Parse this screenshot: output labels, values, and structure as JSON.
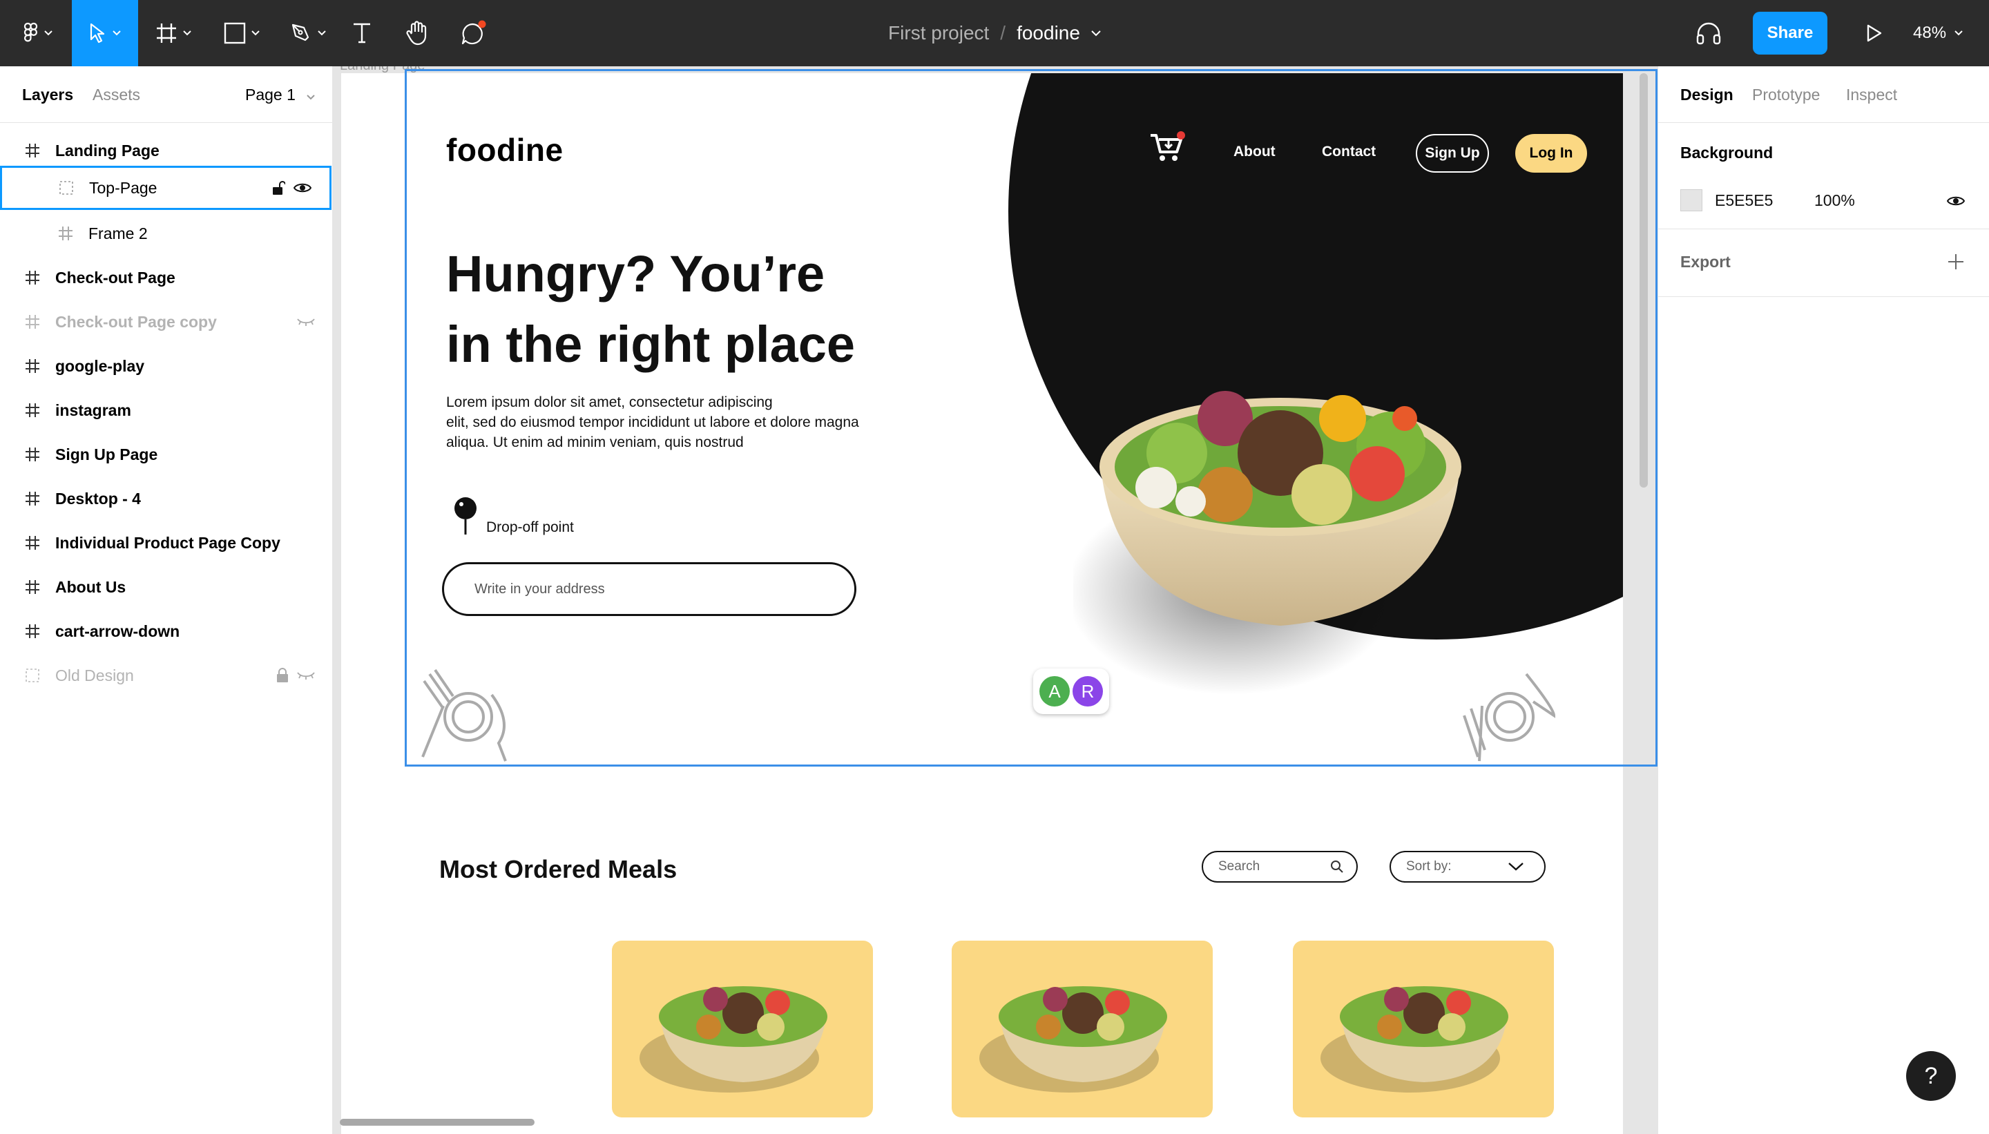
{
  "toolbar": {
    "project": "First project",
    "separator": "/",
    "file": "foodine",
    "share_label": "Share",
    "zoom": "48%",
    "accent": "#0d99ff"
  },
  "left_panel": {
    "tabs": [
      "Layers",
      "Assets"
    ],
    "page_selector": "Page 1",
    "layers": [
      {
        "name": "Landing Page",
        "icon": "frame-icon"
      },
      {
        "name": "Top-Page",
        "icon": "group-icon",
        "child": true,
        "selected": true
      },
      {
        "name": "Frame 2",
        "icon": "frame-icon",
        "child": true
      },
      {
        "name": "Check-out Page",
        "icon": "frame-icon"
      },
      {
        "name": "Check-out Page copy",
        "icon": "frame-icon",
        "hidden": true
      },
      {
        "name": "google-play",
        "icon": "frame-icon"
      },
      {
        "name": "instagram",
        "icon": "frame-icon"
      },
      {
        "name": "Sign Up Page",
        "icon": "frame-icon"
      },
      {
        "name": "Desktop - 4",
        "icon": "frame-icon"
      },
      {
        "name": "Individual Product Page Copy",
        "icon": "frame-icon"
      },
      {
        "name": "About Us",
        "icon": "frame-icon"
      },
      {
        "name": "cart-arrow-down",
        "icon": "frame-icon"
      },
      {
        "name": "Old Design",
        "icon": "group-icon",
        "hidden": true,
        "locked": true
      }
    ]
  },
  "right_panel": {
    "tabs": [
      "Design",
      "Prototype",
      "Inspect"
    ],
    "background_title": "Background",
    "bg_hex": "E5E5E5",
    "bg_opacity": "100%",
    "bg_color": "#e5e5e5",
    "export_title": "Export"
  },
  "canvas": {
    "frame_label": "Landing Page",
    "landing": {
      "logo": "foodine",
      "nav": [
        "About",
        "Contact"
      ],
      "signup": "Sign Up",
      "login": "Log In",
      "headline_1": "Hungry? You’re",
      "headline_2": "in the right place",
      "lorem_1": "Lorem ipsum dolor sit amet, consectetur adipiscing",
      "lorem_2": "elit, sed do eiusmod tempor incididunt ut labore et dolore magna",
      "lorem_3": "aliqua. Ut enim ad minim veniam, quis nostrud",
      "dropoff": "Drop-off point",
      "address_placeholder": "Write in your address",
      "avatars": [
        {
          "letter": "A",
          "color": "#4caf50"
        },
        {
          "letter": "R",
          "color": "#8b45e8"
        }
      ],
      "section_title": "Most Ordered Meals",
      "search_placeholder": "Search",
      "sort_label": "Sort by:",
      "card_color": "#fbd883"
    }
  },
  "help": "?"
}
